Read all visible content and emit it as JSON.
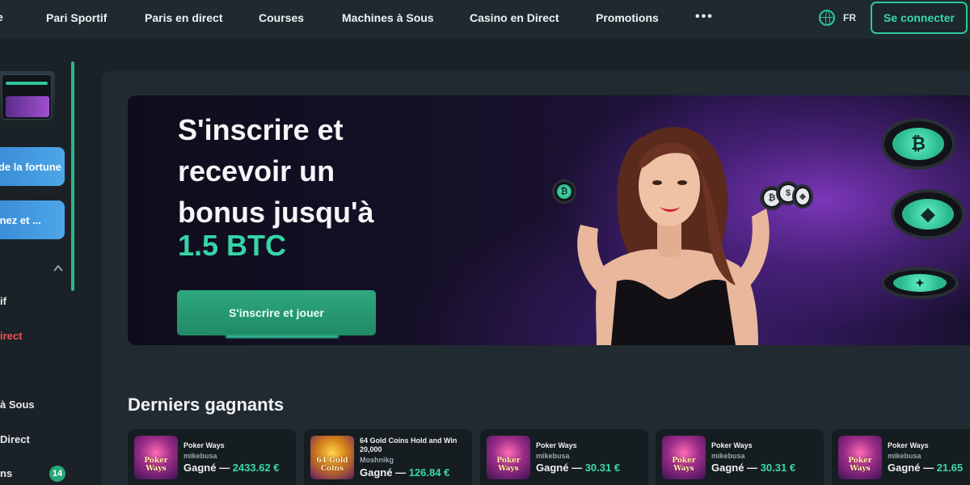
{
  "nav": {
    "edge_label": "e",
    "items": [
      "Pari Sportif",
      "Paris en direct",
      "Courses",
      "Machines à Sous",
      "Casino en Direct",
      "Promotions"
    ],
    "more": "•••",
    "language": "FR",
    "login": "Se connecter"
  },
  "sidebar": {
    "buttons": [
      "de la fortune",
      "inez et ..."
    ],
    "items": [
      "if",
      "irect",
      "à Sous",
      "Direct",
      "ns"
    ],
    "badge_count": "14"
  },
  "hero": {
    "title_lines": [
      "S'inscrire et",
      "recevoir un",
      "bonus jusqu'à"
    ],
    "amount": "1.5 BTC",
    "cta": "S'inscrire et jouer"
  },
  "winners": {
    "title": "Derniers gagnants",
    "cards": [
      {
        "game": "Poker Ways",
        "user": "mikebusa",
        "label": "Gagné —",
        "amount": "2433.62 €",
        "thumb": "poker",
        "thumb_text": "Poker Ways"
      },
      {
        "game": "64 Gold Coins Hold and Win 20,000",
        "user": "Moshnikg",
        "label": "Gagné —",
        "amount": "126.84 €",
        "thumb": "gold",
        "thumb_text": "64 Gold Coins"
      },
      {
        "game": "Poker Ways",
        "user": "mikebusa",
        "label": "Gagné —",
        "amount": "30.31 €",
        "thumb": "poker",
        "thumb_text": "Poker Ways"
      },
      {
        "game": "Poker Ways",
        "user": "mikebusa",
        "label": "Gagné —",
        "amount": "30.31 €",
        "thumb": "poker",
        "thumb_text": "Poker Ways"
      },
      {
        "game": "Poker Ways",
        "user": "mikebusa",
        "label": "Gagné —",
        "amount": "21.65",
        "thumb": "poker",
        "thumb_text": "Poker Ways"
      }
    ]
  },
  "colors": {
    "accent": "#2fc79b",
    "amount_green": "#35d6a5",
    "live_red": "#f05252",
    "side_button_blue": "#4ea7e8"
  }
}
